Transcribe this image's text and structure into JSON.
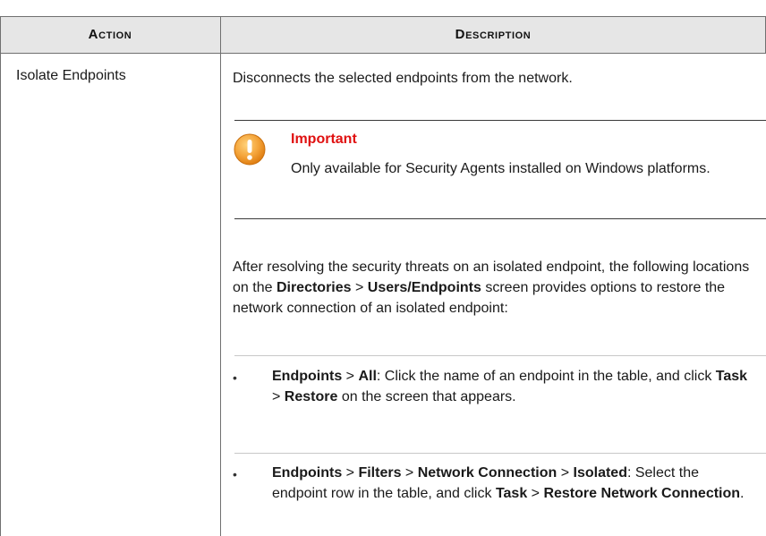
{
  "header": {
    "action_label": "Action",
    "description_label": "Description"
  },
  "row": {
    "action": "Isolate Endpoints",
    "description": "Disconnects the selected endpoints from the network."
  },
  "important": {
    "title": "Important",
    "body": "Only available for Security Agents installed on Windows platforms.",
    "icon": "exclamation-circle-icon",
    "title_color": "#e01010",
    "icon_color": "#f4a43a"
  },
  "after_resolving": {
    "t1": "After resolving the security threats on an isolated endpoint, the following locations on the ",
    "b1": "Directories",
    "t2": " > ",
    "b2": "Users/Endpoints",
    "t3": " screen provides options to restore the network connection of an isolated endpoint:"
  },
  "list": [
    {
      "b1": "Endpoints",
      "t1": " > ",
      "b2": "All",
      "t2": ": Click the name of an endpoint in the table, and click ",
      "b3": "Task",
      "t3": " > ",
      "b4": "Restore",
      "t4": " on the screen that appears."
    },
    {
      "b1": "Endpoints",
      "t1": " > ",
      "b2": "Filters",
      "t2": " > ",
      "b3": "Network Connection",
      "t3": " > ",
      "b4": "Isolated",
      "t4": ": Select the endpoint row in the table, and click ",
      "b5": "Task",
      "t5": " > ",
      "b6": "Restore Network Connection",
      "t6": "."
    }
  ],
  "bullet_glyph": "•"
}
